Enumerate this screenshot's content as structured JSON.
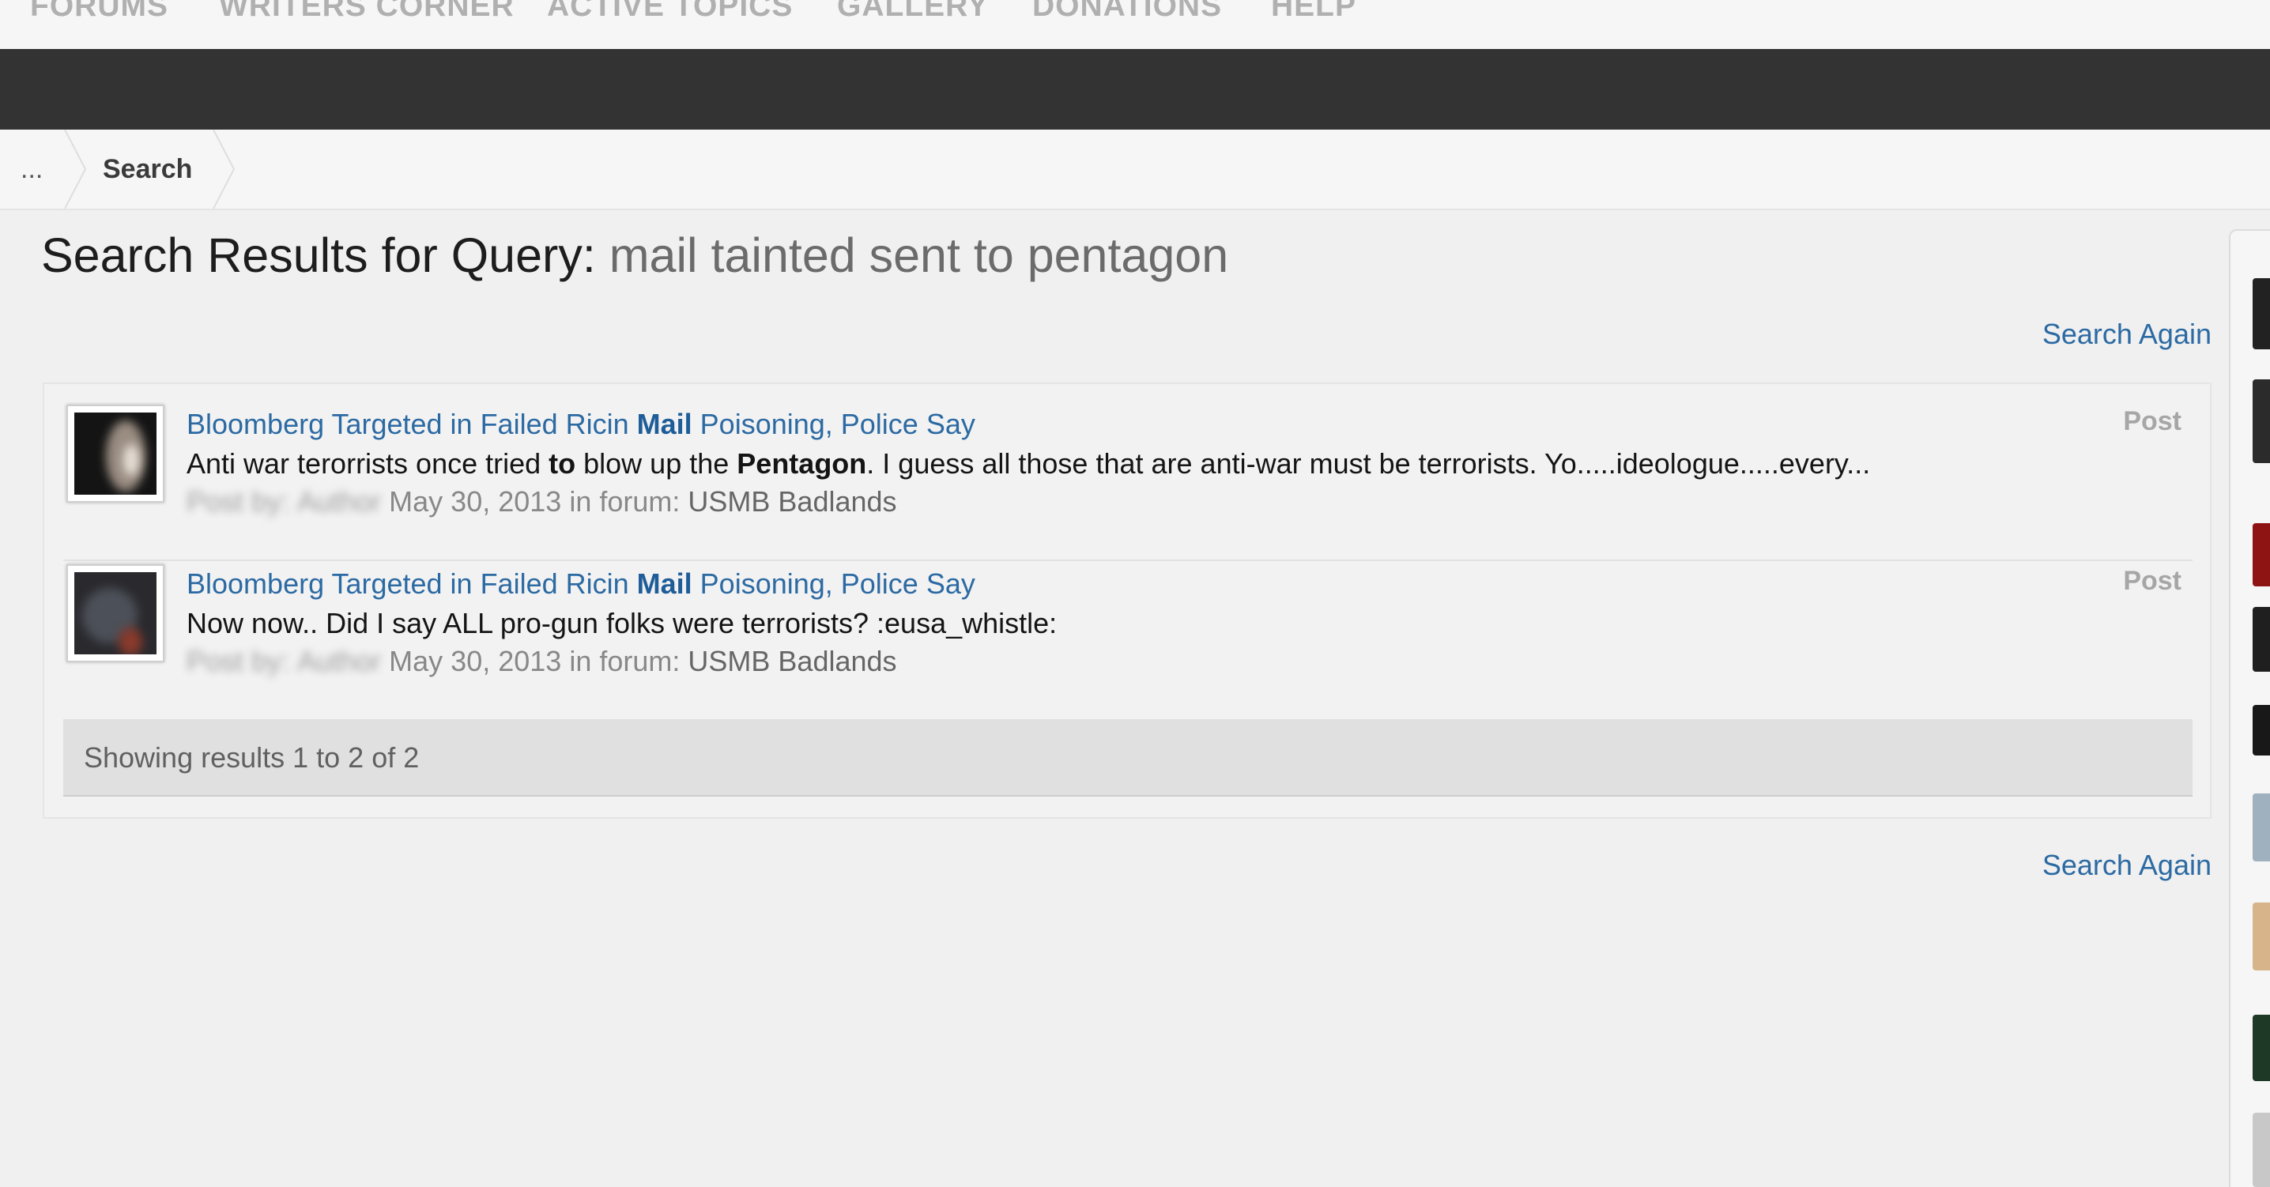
{
  "nav": {
    "items": [
      {
        "label": "FORUMS"
      },
      {
        "label": "WRITERS CORNER"
      },
      {
        "label": "ACTIVE TOPICS"
      },
      {
        "label": "GALLERY"
      },
      {
        "label": "DONATIONS"
      },
      {
        "label": "HELP"
      }
    ]
  },
  "breadcrumb": {
    "ellipsis": "...",
    "current": "Search"
  },
  "page": {
    "title_prefix": "Search Results for Query:",
    "query": "mail tainted sent to pentagon",
    "search_again": "Search Again"
  },
  "results": [
    {
      "title_before": "Bloomberg Targeted in Failed Ricin ",
      "title_highlight": "Mail",
      "title_after": " Poisoning, Police Say",
      "snippet_1": "Anti war terorrists once tried ",
      "snippet_bold_1": "to",
      "snippet_2": " blow up the ",
      "snippet_bold_2": "Pentagon",
      "snippet_3": ". I guess all those that are anti-war must be terrorists. Yo.....ideologue.....every...",
      "posted_by_label": "Post by:",
      "author": "Author",
      "date": "May 30, 2013",
      "forum_label": "in forum:",
      "forum": "USMB Badlands",
      "type": "Post"
    },
    {
      "title_before": "Bloomberg Targeted in Failed Ricin ",
      "title_highlight": "Mail",
      "title_after": " Poisoning, Police Say",
      "snippet_1": "Now now.. Did I say ALL pro-gun folks were terrorists? :eusa_whistle:",
      "posted_by_label": "Post by:",
      "author": "Author",
      "date": "May 30, 2013",
      "forum_label": "in forum:",
      "forum": "USMB Badlands",
      "type": "Post"
    }
  ],
  "summary": "Showing results 1 to 2 of 2",
  "colors": {
    "link": "#2c6aa3",
    "dark_bar": "#333333",
    "background": "#f0f0f0"
  }
}
